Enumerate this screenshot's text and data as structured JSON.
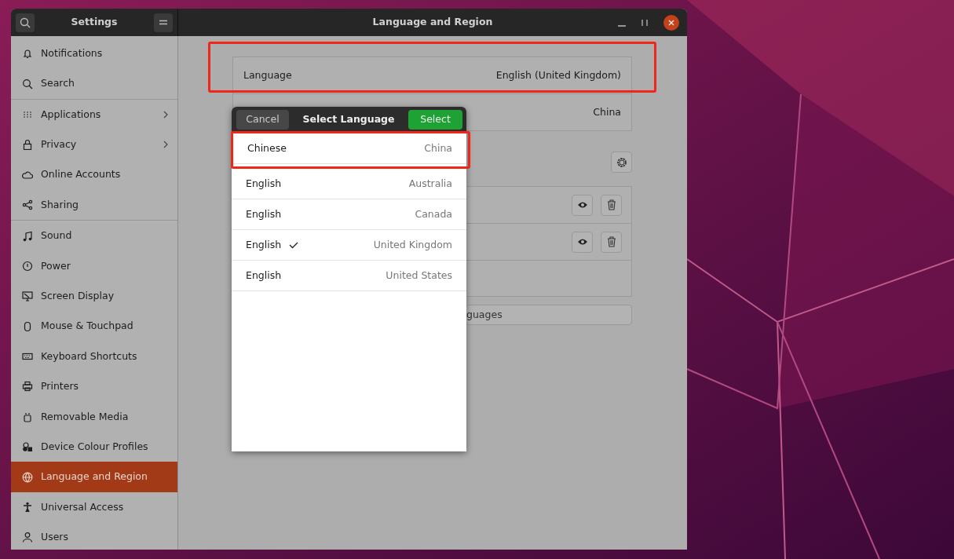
{
  "window": {
    "sidebar_title": "Settings",
    "title": "Language and Region"
  },
  "sidebar": {
    "groups": [
      [
        {
          "label": "Notifications",
          "selected": false,
          "has_submenu": false
        },
        {
          "label": "Search",
          "selected": false,
          "has_submenu": false
        }
      ],
      [
        {
          "label": "Applications",
          "selected": false,
          "has_submenu": true
        },
        {
          "label": "Privacy",
          "selected": false,
          "has_submenu": true
        },
        {
          "label": "Online Accounts",
          "selected": false,
          "has_submenu": false
        },
        {
          "label": "Sharing",
          "selected": false,
          "has_submenu": false
        }
      ],
      [
        {
          "label": "Sound",
          "selected": false,
          "has_submenu": false
        },
        {
          "label": "Power",
          "selected": false,
          "has_submenu": false
        },
        {
          "label": "Screen Display",
          "selected": false,
          "has_submenu": false
        },
        {
          "label": "Mouse & Touchpad",
          "selected": false,
          "has_submenu": false
        },
        {
          "label": "Keyboard Shortcuts",
          "selected": false,
          "has_submenu": false
        },
        {
          "label": "Printers",
          "selected": false,
          "has_submenu": false
        },
        {
          "label": "Removable Media",
          "selected": false,
          "has_submenu": false
        },
        {
          "label": "Device Colour Profiles",
          "selected": false,
          "has_submenu": false
        },
        {
          "label": "Language and Region",
          "selected": true,
          "has_submenu": false
        },
        {
          "label": "Universal Access",
          "selected": false,
          "has_submenu": false
        },
        {
          "label": "Users",
          "selected": false,
          "has_submenu": false
        }
      ]
    ]
  },
  "main": {
    "rows": [
      {
        "label": "Language",
        "value": "English (United Kingdom)"
      },
      {
        "value": "China"
      }
    ],
    "manage_button": "guages"
  },
  "dialog": {
    "title": "Select Language",
    "cancel": "Cancel",
    "confirm": "Select",
    "options": [
      {
        "language": "Chinese",
        "region": "China",
        "checked": false
      },
      {
        "language": "English",
        "region": "Australia",
        "checked": false
      },
      {
        "language": "English",
        "region": "Canada",
        "checked": false
      },
      {
        "language": "English",
        "region": "United Kingdom",
        "checked": true
      },
      {
        "language": "English",
        "region": "United States",
        "checked": false
      }
    ]
  }
}
